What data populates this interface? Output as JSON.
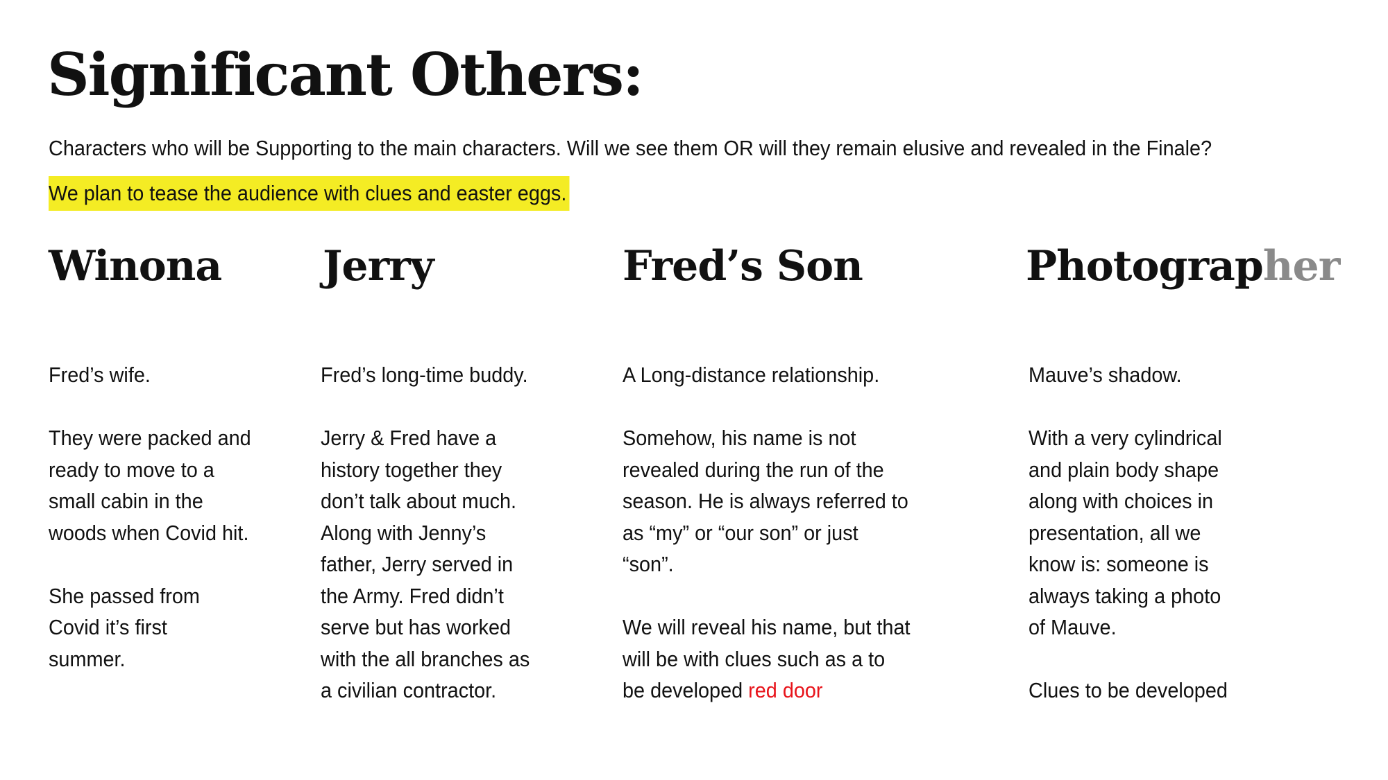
{
  "title": "Significant Others:",
  "subtitle": "Characters who will be Supporting to the main characters. Will we see them OR will they remain elusive and revealed in the Finale?",
  "highlight": "We plan to tease the audience with clues and easter eggs.",
  "colors": {
    "highlight": "#f4ec24",
    "red_text": "#e8141b",
    "faded_text": "#8a8a8a"
  },
  "columns": [
    {
      "name": "Winona",
      "paragraphs": [
        [
          "Fred’s wife."
        ],
        [
          "They were packed and",
          "ready to move to a",
          "small cabin in the",
          "woods when Covid hit."
        ],
        [
          "She passed from",
          "Covid it’s first",
          "summer."
        ]
      ]
    },
    {
      "name": "Jerry",
      "paragraphs": [
        [
          "Fred’s long-time buddy."
        ],
        [
          "Jerry & Fred have a",
          "history together they",
          "don’t talk about much.",
          "Along with Jenny’s",
          "father, Jerry served in",
          "the Army. Fred didn’t",
          "serve but has worked",
          "with the all branches as",
          "a civilian contractor."
        ]
      ]
    },
    {
      "name": "Fred’s Son",
      "paragraphs": [
        [
          "A Long-distance relationship."
        ],
        [
          "Somehow, his name is not",
          "revealed during the run of the",
          "season. He is always referred to",
          "as “my” or “our son” or just",
          "“son”."
        ],
        [
          "We will reveal his name, but that",
          "will be with clues such as a to"
        ]
      ],
      "last_line_prefix": "be developed ",
      "last_line_red": "red door"
    },
    {
      "name_main": "Photograp",
      "name_faded": "her",
      "paragraphs": [
        [
          "Mauve’s shadow."
        ],
        [
          "With a very cylindrical",
          "and plain body shape",
          "along with choices in",
          "presentation, all we",
          "know is: someone is",
          "always taking a photo",
          "of Mauve."
        ],
        [
          "Clues to be developed"
        ]
      ]
    }
  ]
}
